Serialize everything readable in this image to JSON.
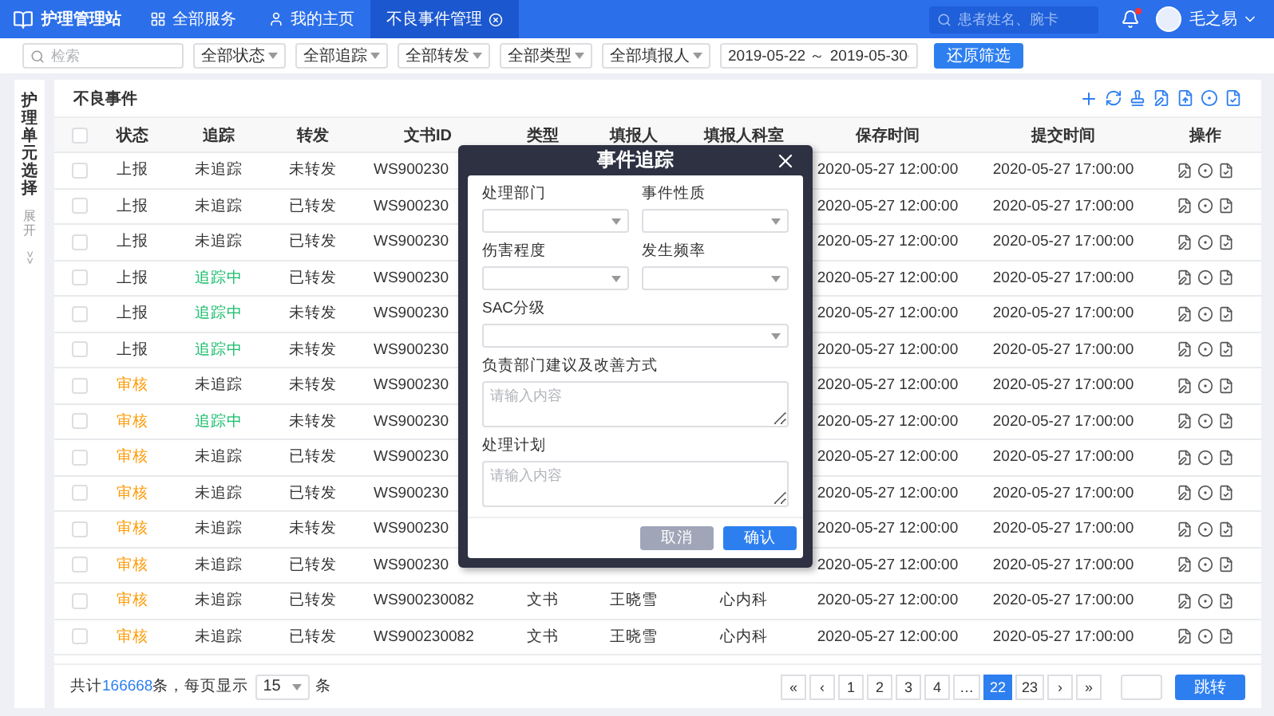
{
  "topbar": {
    "app_title": "护理管理站",
    "tabs": [
      {
        "label": "全部服务",
        "kind": "grid",
        "selected": false,
        "closable": false
      },
      {
        "label": "我的主页",
        "kind": "user",
        "selected": false,
        "closable": false
      },
      {
        "label": "不良事件管理",
        "kind": "none",
        "selected": true,
        "closable": true
      }
    ],
    "search": {
      "placeholder": "患者姓名、腕卡"
    },
    "notification": true,
    "user_name": "毛之易"
  },
  "filters": {
    "search": {
      "placeholder": "检索"
    },
    "selects": [
      "全部状态",
      "全部追踪",
      "全部转发",
      "全部类型",
      "全部填报人"
    ],
    "date_range": "2019-05-22 ～ 2019-05-30",
    "reset_button": "还原筛选"
  },
  "sidebar": {
    "title": "护理单元选择",
    "expand": "展开",
    "expand_arrow": ">>"
  },
  "card": {
    "title": "不良事件"
  },
  "table": {
    "header_checked": false,
    "columns": [
      "状态",
      "追踪",
      "转发",
      "文书ID",
      "类型",
      "填报人",
      "填报人科室",
      "保存时间",
      "提交时间",
      "操作"
    ],
    "rows": [
      {
        "checked": false,
        "status": {
          "text": "上报",
          "color": "#333333"
        },
        "tracking": {
          "text": "未追踪",
          "color": "#333333"
        },
        "forward": "未转发",
        "doc_id": "WS900230",
        "save_time": "2020-05-27 12:00:00",
        "submit_time": "2020-05-27 17:00:00"
      },
      {
        "checked": false,
        "status": {
          "text": "上报",
          "color": "#333333"
        },
        "tracking": {
          "text": "未追踪",
          "color": "#333333"
        },
        "forward": "已转发",
        "doc_id": "WS900230",
        "save_time": "2020-05-27 12:00:00",
        "submit_time": "2020-05-27 17:00:00"
      },
      {
        "checked": false,
        "status": {
          "text": "上报",
          "color": "#333333"
        },
        "tracking": {
          "text": "未追踪",
          "color": "#333333"
        },
        "forward": "已转发",
        "doc_id": "WS900230",
        "save_time": "2020-05-27 12:00:00",
        "submit_time": "2020-05-27 17:00:00"
      },
      {
        "checked": false,
        "status": {
          "text": "上报",
          "color": "#333333"
        },
        "tracking": {
          "text": "追踪中",
          "color": "#19be6b"
        },
        "forward": "已转发",
        "doc_id": "WS900230",
        "save_time": "2020-05-27 12:00:00",
        "submit_time": "2020-05-27 17:00:00"
      },
      {
        "checked": false,
        "status": {
          "text": "上报",
          "color": "#333333"
        },
        "tracking": {
          "text": "追踪中",
          "color": "#19be6b"
        },
        "forward": "未转发",
        "doc_id": "WS900230",
        "save_time": "2020-05-27 12:00:00",
        "submit_time": "2020-05-27 17:00:00"
      },
      {
        "checked": false,
        "status": {
          "text": "上报",
          "color": "#333333"
        },
        "tracking": {
          "text": "追踪中",
          "color": "#19be6b"
        },
        "forward": "未转发",
        "doc_id": "WS900230",
        "save_time": "2020-05-27 12:00:00",
        "submit_time": "2020-05-27 17:00:00"
      },
      {
        "checked": false,
        "status": {
          "text": "审核",
          "color": "#ff9900"
        },
        "tracking": {
          "text": "未追踪",
          "color": "#333333"
        },
        "forward": "未转发",
        "doc_id": "WS900230",
        "save_time": "2020-05-27 12:00:00",
        "submit_time": "2020-05-27 17:00:00"
      },
      {
        "checked": false,
        "status": {
          "text": "审核",
          "color": "#ff9900"
        },
        "tracking": {
          "text": "追踪中",
          "color": "#19be6b"
        },
        "forward": "未转发",
        "doc_id": "WS900230",
        "save_time": "2020-05-27 12:00:00",
        "submit_time": "2020-05-27 17:00:00"
      },
      {
        "checked": false,
        "status": {
          "text": "审核",
          "color": "#ff9900"
        },
        "tracking": {
          "text": "未追踪",
          "color": "#333333"
        },
        "forward": "已转发",
        "doc_id": "WS900230",
        "save_time": "2020-05-27 12:00:00",
        "submit_time": "2020-05-27 17:00:00"
      },
      {
        "checked": false,
        "status": {
          "text": "审核",
          "color": "#ff9900"
        },
        "tracking": {
          "text": "未追踪",
          "color": "#333333"
        },
        "forward": "已转发",
        "doc_id": "WS900230",
        "save_time": "2020-05-27 12:00:00",
        "submit_time": "2020-05-27 17:00:00"
      },
      {
        "checked": false,
        "status": {
          "text": "审核",
          "color": "#ff9900"
        },
        "tracking": {
          "text": "未追踪",
          "color": "#333333"
        },
        "forward": "未转发",
        "doc_id": "WS900230",
        "save_time": "2020-05-27 12:00:00",
        "submit_time": "2020-05-27 17:00:00"
      },
      {
        "checked": false,
        "status": {
          "text": "审核",
          "color": "#ff9900"
        },
        "tracking": {
          "text": "未追踪",
          "color": "#333333"
        },
        "forward": "已转发",
        "doc_id": "WS900230",
        "save_time": "2020-05-27 12:00:00",
        "submit_time": "2020-05-27 17:00:00"
      },
      {
        "checked": false,
        "status": {
          "text": "审核",
          "color": "#ff9900"
        },
        "tracking": {
          "text": "未追踪",
          "color": "#333333"
        },
        "forward": "已转发",
        "doc_id": "WS900230082",
        "type": "文书",
        "reporter": "王晓雪",
        "department": "心内科",
        "save_time": "2020-05-27 12:00:00",
        "submit_time": "2020-05-27 17:00:00"
      },
      {
        "checked": false,
        "status": {
          "text": "审核",
          "color": "#ff9900"
        },
        "tracking": {
          "text": "未追踪",
          "color": "#333333"
        },
        "forward": "已转发",
        "doc_id": "WS900230082",
        "type": "文书",
        "reporter": "王晓雪",
        "department": "心内科",
        "save_time": "2020-05-27 12:00:00",
        "submit_time": "2020-05-27 17:00:00"
      }
    ]
  },
  "footer": {
    "total_prefix": "共计",
    "total": "166668",
    "total_suffix": "条，每页显示",
    "page_size": "15",
    "page_size_suffix": "条",
    "pages": [
      {
        "label": "«",
        "selected": false
      },
      {
        "label": "‹",
        "selected": false
      },
      {
        "label": "1",
        "selected": false
      },
      {
        "label": "2",
        "selected": false
      },
      {
        "label": "3",
        "selected": false
      },
      {
        "label": "4",
        "selected": false
      },
      {
        "label": "…",
        "selected": false
      },
      {
        "label": "22",
        "selected": true
      },
      {
        "label": "23",
        "selected": false
      },
      {
        "label": "›",
        "selected": false
      },
      {
        "label": "»",
        "selected": false
      }
    ],
    "jump_button": "跳转"
  },
  "dialog": {
    "title": "事件追踪",
    "fields": [
      {
        "kind": "select",
        "label": "处理部门"
      },
      {
        "kind": "select",
        "label": "事件性质"
      },
      {
        "kind": "select",
        "label": "伤害程度"
      },
      {
        "kind": "select",
        "label": "发生频率"
      },
      {
        "kind": "wide_select",
        "label": "SAC分级"
      },
      {
        "kind": "textarea",
        "label": "负责部门建议及改善方式",
        "placeholder": "请输入内容"
      },
      {
        "kind": "textarea",
        "label": "处理计划",
        "placeholder": "请输入内容"
      }
    ],
    "cancel_button": "取消",
    "confirm_button": "确认"
  }
}
